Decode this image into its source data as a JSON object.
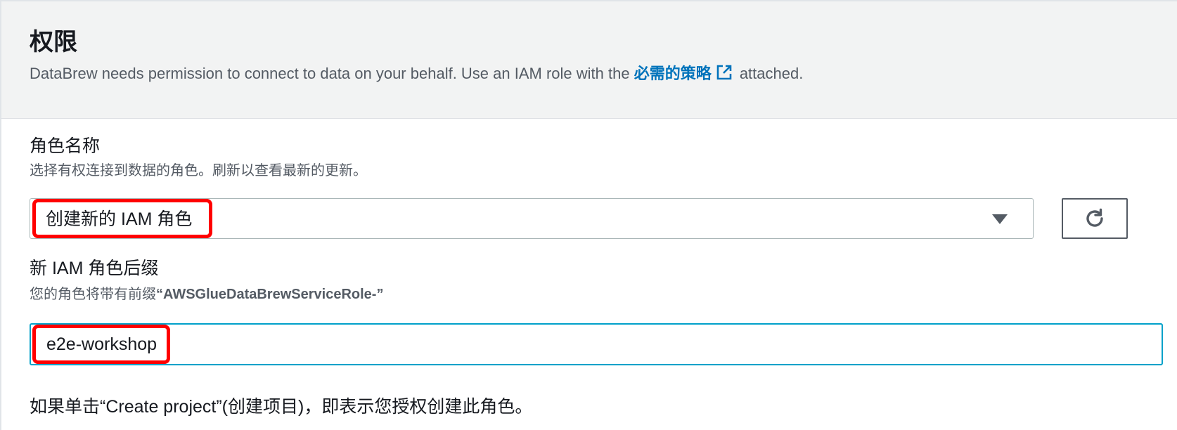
{
  "permissions": {
    "title": "权限",
    "description_prefix": "DataBrew needs permission to connect to data on your behalf. Use an IAM role with the ",
    "policy_link": "必需的策略",
    "description_suffix": " attached.",
    "link_icon": "external-link-icon"
  },
  "role_name": {
    "label": "角色名称",
    "hint": "选择有权连接到数据的角色。刷新以查看最新的更新。",
    "selected_value": "创建新的 IAM 角色",
    "dropdown_icon": "caret-down-icon",
    "refresh_icon": "refresh-icon"
  },
  "role_suffix": {
    "label": "新 IAM 角色后缀",
    "hint_prefix": "您的角色将带有前缀",
    "hint_value": "“AWSGlueDataBrewServiceRole-”",
    "input_value": "e2e-workshop"
  },
  "footer": {
    "note": "如果单击“Create project”(创建项目)，即表示您授权创建此角色。"
  },
  "colors": {
    "link": "#0073bb",
    "focus_border": "#00a1c9",
    "highlight": "#ff0000",
    "header_bg": "#f2f3f3"
  }
}
